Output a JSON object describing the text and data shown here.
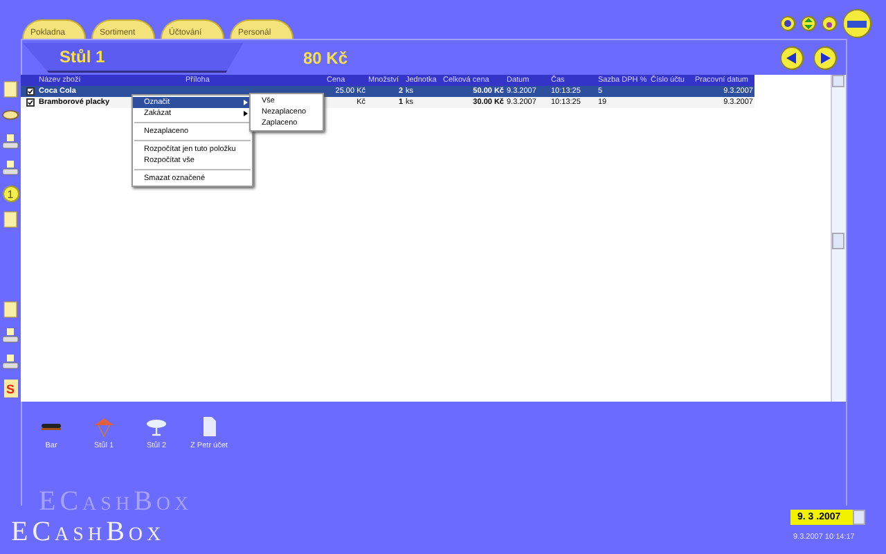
{
  "tabs": [
    {
      "label": "Pokladna"
    },
    {
      "label": "Sortiment"
    },
    {
      "label": "Účtování"
    },
    {
      "label": "Personál"
    }
  ],
  "header": {
    "table_name": "Stůl 1",
    "total": "80 Kč"
  },
  "side_badge": "1",
  "side_s": "S",
  "table": {
    "columns": [
      "Název zboží",
      "Příloha",
      "Cena",
      "Množství",
      "Jednotka",
      "Celková cena",
      "Datum",
      "Čas",
      "Sazba DPH %",
      "Číslo účtu",
      "Pracovní datum"
    ],
    "rows": [
      {
        "selected": true,
        "checked": true,
        "cells": [
          "Coca Cola",
          "",
          "25.00 Kč",
          "2",
          "ks",
          "50.00 Kč",
          "9.3.2007",
          "10:13:25",
          "5",
          "",
          "9.3.2007"
        ]
      },
      {
        "selected": false,
        "checked": true,
        "cells": [
          "Bramborové placky",
          "",
          "Kč",
          "1",
          "ks",
          "30.00 Kč",
          "9.3.2007",
          "10:13:25",
          "19",
          "",
          "9.3.2007"
        ]
      }
    ]
  },
  "context_menu": [
    {
      "kind": "item",
      "label": "Označit",
      "submenu": true,
      "selected": true
    },
    {
      "kind": "item",
      "label": "Zakázat",
      "submenu": true,
      "selected": false
    },
    {
      "kind": "separator"
    },
    {
      "kind": "item",
      "label": "Nezaplaceno",
      "submenu": false,
      "selected": false
    },
    {
      "kind": "separator"
    },
    {
      "kind": "item",
      "label": "Rozpočítat jen tuto položku",
      "submenu": false,
      "selected": false
    },
    {
      "kind": "item",
      "label": "Rozpočítat vše",
      "submenu": false,
      "selected": false
    },
    {
      "kind": "separator"
    },
    {
      "kind": "item",
      "label": "Smazat označené",
      "submenu": false,
      "selected": false
    }
  ],
  "submenu": [
    "Vše",
    "Nezaplaceno",
    "Zaplaceno"
  ],
  "tables": [
    {
      "label": "Bar",
      "kind": "bar"
    },
    {
      "label": "Stůl 1",
      "kind": "umbrella"
    },
    {
      "label": "Stůl 2",
      "kind": "lamp"
    },
    {
      "label": "Z Petr účet",
      "kind": "page"
    }
  ],
  "logo": "ECashBox",
  "logo_shadow": "ECashBox",
  "date": "9. 3 .2007",
  "timestamp": "9.3.2007 10:14:17"
}
